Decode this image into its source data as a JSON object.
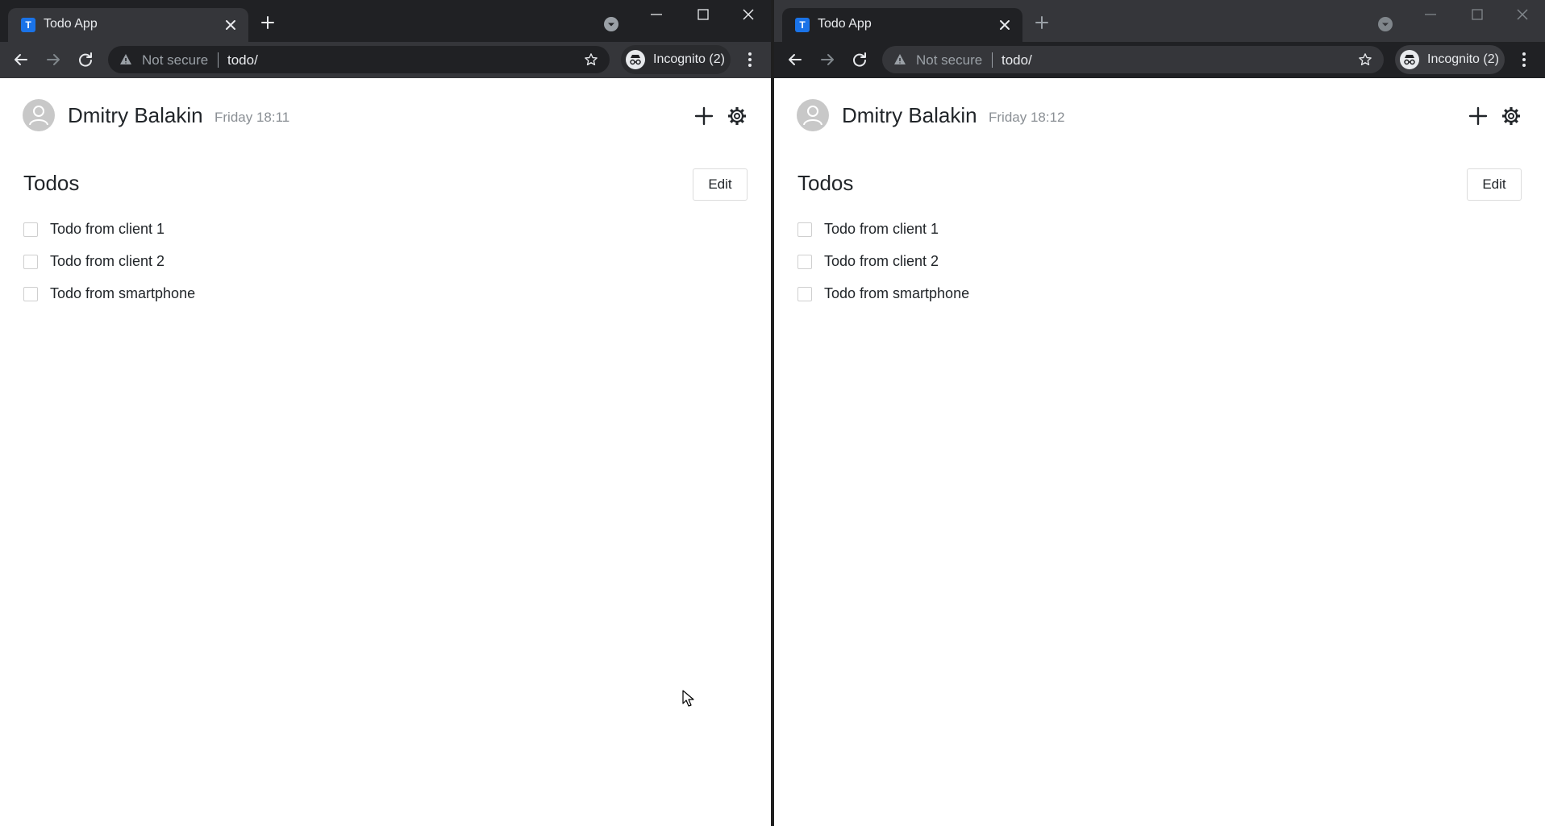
{
  "windows": [
    {
      "tab_title": "Todo App",
      "favicon_letter": "T",
      "address": {
        "security": "Not secure",
        "url": "todo/"
      },
      "profile_label": "Incognito (2)",
      "app": {
        "user_name": "Dmitry Balakin",
        "timestamp": "Friday 18:11",
        "section_title": "Todos",
        "edit_label": "Edit",
        "todos": [
          {
            "label": "Todo from client 1",
            "checked": false
          },
          {
            "label": "Todo from client 2",
            "checked": false
          },
          {
            "label": "Todo from smartphone",
            "checked": false
          }
        ]
      }
    },
    {
      "tab_title": "Todo App",
      "favicon_letter": "T",
      "address": {
        "security": "Not secure",
        "url": "todo/"
      },
      "profile_label": "Incognito (2)",
      "app": {
        "user_name": "Dmitry Balakin",
        "timestamp": "Friday 18:12",
        "section_title": "Todos",
        "edit_label": "Edit",
        "todos": [
          {
            "label": "Todo from client 1",
            "checked": false
          },
          {
            "label": "Todo from client 2",
            "checked": false
          },
          {
            "label": "Todo from smartphone",
            "checked": false
          }
        ]
      }
    }
  ],
  "colors": {
    "chrome_dark": "#202124",
    "chrome_mid": "#35363a",
    "chrome_text": "#e8eaed",
    "chrome_muted": "#9aa0a6",
    "favicon_blue": "#1a73e8",
    "page_text": "#212529",
    "timestamp_gray": "#8a8f94"
  },
  "icons": [
    "close-icon",
    "plus-icon",
    "tab-search-icon",
    "minimize-icon",
    "maximize-icon",
    "back-arrow-icon",
    "forward-arrow-icon",
    "reload-icon",
    "warning-icon",
    "star-icon",
    "incognito-icon",
    "more-vert-icon",
    "avatar-person-icon",
    "add-icon",
    "gear-icon",
    "mouse-cursor-icon"
  ]
}
